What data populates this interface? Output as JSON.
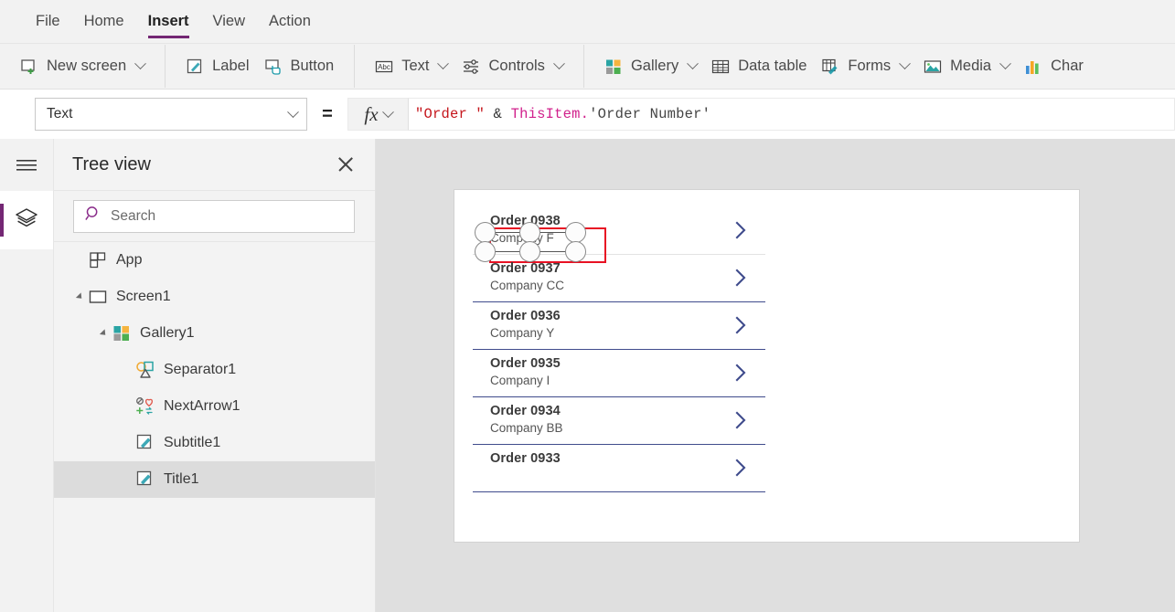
{
  "menu": {
    "items": [
      {
        "label": "File",
        "active": false
      },
      {
        "label": "Home",
        "active": false
      },
      {
        "label": "Insert",
        "active": true
      },
      {
        "label": "View",
        "active": false
      },
      {
        "label": "Action",
        "active": false
      }
    ]
  },
  "ribbon": {
    "groups": [
      {
        "buttons": [
          {
            "label": "New screen",
            "icon": "new-screen-icon",
            "caret": true
          }
        ]
      },
      {
        "buttons": [
          {
            "label": "Label",
            "icon": "label-icon",
            "caret": false
          },
          {
            "label": "Button",
            "icon": "button-icon",
            "caret": false
          }
        ]
      },
      {
        "buttons": [
          {
            "label": "Text",
            "icon": "text-abc-icon",
            "caret": true
          },
          {
            "label": "Controls",
            "icon": "sliders-icon",
            "caret": true
          }
        ]
      },
      {
        "buttons": [
          {
            "label": "Gallery",
            "icon": "gallery-icon",
            "caret": true
          },
          {
            "label": "Data table",
            "icon": "data-table-icon",
            "caret": false
          },
          {
            "label": "Forms",
            "icon": "forms-icon",
            "caret": true
          },
          {
            "label": "Media",
            "icon": "media-icon",
            "caret": true
          },
          {
            "label": "Char",
            "icon": "charts-icon",
            "caret": false
          }
        ]
      }
    ]
  },
  "formula_bar": {
    "property": "Text",
    "equals": "=",
    "fx_label": "fx",
    "formula_tokens": [
      {
        "text": "\"Order \"",
        "color": "#c5161c"
      },
      {
        "text": " ",
        "color": "#333333"
      },
      {
        "text": "&",
        "color": "#333333"
      },
      {
        "text": " ",
        "color": "#333333"
      },
      {
        "text": "ThisItem",
        "color": "#d1218c"
      },
      {
        "text": ".",
        "color": "#d1218c"
      },
      {
        "text": "'Order Number'",
        "color": "#444444"
      }
    ],
    "formula_plain": "\"Order \" & ThisItem.'Order Number'"
  },
  "rail": {
    "hamburger": "hamburger-icon",
    "buttons": [
      {
        "icon": "layers-icon",
        "active": true
      }
    ]
  },
  "tree_panel": {
    "title": "Tree view",
    "close": "close-icon",
    "search": {
      "value": "",
      "placeholder": "Search",
      "icon": "search-icon"
    },
    "nodes": [
      {
        "label": "App",
        "icon": "app-icon",
        "indent": 0,
        "twisty": false,
        "selected": false
      },
      {
        "label": "Screen1",
        "icon": "screen-icon",
        "indent": 0,
        "twisty": true,
        "selected": false
      },
      {
        "label": "Gallery1",
        "icon": "gallery-icon",
        "indent": 1,
        "twisty": true,
        "selected": false
      },
      {
        "label": "Separator1",
        "icon": "separator-icon",
        "indent": 2,
        "twisty": false,
        "selected": false
      },
      {
        "label": "NextArrow1",
        "icon": "icon-control-icon",
        "indent": 2,
        "twisty": false,
        "selected": false
      },
      {
        "label": "Subtitle1",
        "icon": "label-icon",
        "indent": 2,
        "twisty": false,
        "selected": false
      },
      {
        "label": "Title1",
        "icon": "label-icon",
        "indent": 2,
        "twisty": false,
        "selected": true
      }
    ]
  },
  "canvas": {
    "gallery": {
      "rows": [
        {
          "title": "Order 0938",
          "subtitle": "Company F",
          "chevron": true,
          "selected": true,
          "clipped": false
        },
        {
          "title": "Order 0937",
          "subtitle": "Company CC",
          "chevron": true,
          "selected": false,
          "clipped": false
        },
        {
          "title": "Order 0936",
          "subtitle": "Company Y",
          "chevron": true,
          "selected": false,
          "clipped": false
        },
        {
          "title": "Order 0935",
          "subtitle": "Company I",
          "chevron": true,
          "selected": false,
          "clipped": false
        },
        {
          "title": "Order 0934",
          "subtitle": "Company BB",
          "chevron": true,
          "selected": false,
          "clipped": false
        },
        {
          "title": "Order 0933",
          "subtitle": "",
          "chevron": true,
          "selected": false,
          "clipped": true
        }
      ]
    },
    "selection": {
      "color": "#e81123",
      "handle_count": 6,
      "target": "Title1"
    }
  },
  "colors": {
    "accent_purple": "#742774",
    "selection_red": "#e81123",
    "separator_navy": "#3f4b8c",
    "chevron_navy": "#3f4b8c",
    "ribbon_bg": "#f2f2f2",
    "workspace_bg": "#dfdfdf"
  }
}
